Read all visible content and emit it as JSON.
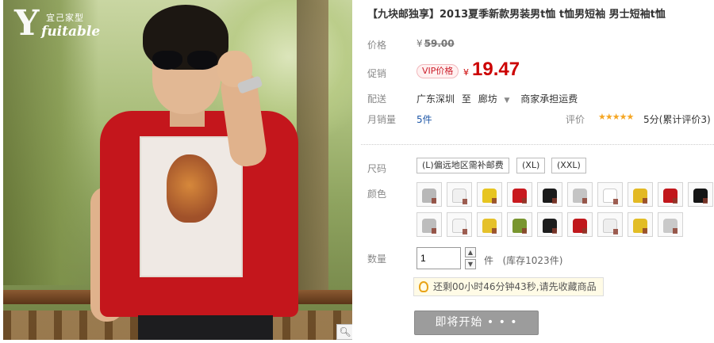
{
  "brand": {
    "mark": "Y",
    "cn": "宜己家型",
    "en": "fuitable"
  },
  "product": {
    "title": "【九块邮独享】2013夏季新款男装男t恤 t恤男短袖 男士短袖t恤",
    "price_label": "价格",
    "original_price_currency": "¥",
    "original_price": "59.00",
    "promo_label": "促销",
    "vip_badge": "VIP价格",
    "sale_currency": "¥",
    "sale_price": "19.47",
    "ship_label": "配送",
    "ship_from": "广东深圳",
    "ship_to_word": "至",
    "ship_to": "廊坊",
    "ship_fee": "商家承担运费",
    "monthly_sales_label": "月销量",
    "monthly_sales": "5件",
    "rating_label": "评价",
    "stars": "★★★★★",
    "rating_text": "5分(累计评价3)"
  },
  "options": {
    "size_label": "尺码",
    "sizes": [
      "(L)偏远地区需补邮费",
      "(XL)",
      "(XXL)"
    ],
    "color_label": "颜色",
    "colors": [
      {
        "icon": "tshirt-gray-icon",
        "color": "#b8b8b8"
      },
      {
        "icon": "tshirt-white-icon",
        "color": "#f0f0f0"
      },
      {
        "icon": "tshirt-yellow-icon",
        "color": "#e7c520"
      },
      {
        "icon": "tshirt-red-icon",
        "color": "#c8191e"
      },
      {
        "icon": "tshirt-black-icon",
        "color": "#1a1a1a"
      },
      {
        "icon": "tshirt-gray-icon",
        "color": "#c4c4c4"
      },
      {
        "icon": "tshirt-white-icon",
        "color": "#ffffff"
      },
      {
        "icon": "tshirt-yellow-icon",
        "color": "#e3b923"
      },
      {
        "icon": "tshirt-red-icon",
        "color": "#c1161b"
      },
      {
        "icon": "tshirt-black-icon",
        "color": "#151515"
      },
      {
        "icon": "tshirt-gray-icon",
        "color": "#bdbdbd"
      },
      {
        "icon": "tshirt-white-icon",
        "color": "#f4f4f4"
      },
      {
        "icon": "tshirt-yellow-icon",
        "color": "#e5c12a"
      },
      {
        "icon": "tshirt-green-icon",
        "color": "#78952e"
      },
      {
        "icon": "tshirt-black-icon",
        "color": "#1d1d1d"
      },
      {
        "icon": "tshirt-red-icon",
        "color": "#c0181c"
      },
      {
        "icon": "tshirt-white-icon",
        "color": "#eeeeee"
      },
      {
        "icon": "tshirt-yellow-icon",
        "color": "#e2bd25"
      },
      {
        "icon": "tshirt-gray-icon",
        "color": "#c9c9c9"
      }
    ],
    "qty_label": "数量",
    "qty_value": "1",
    "qty_unit": "件",
    "stock": "(库存1023件)"
  },
  "countdown": {
    "text": "还剩00小时46分钟43秒,请先收藏商品"
  },
  "action": {
    "button": "即将开始 • • •"
  }
}
